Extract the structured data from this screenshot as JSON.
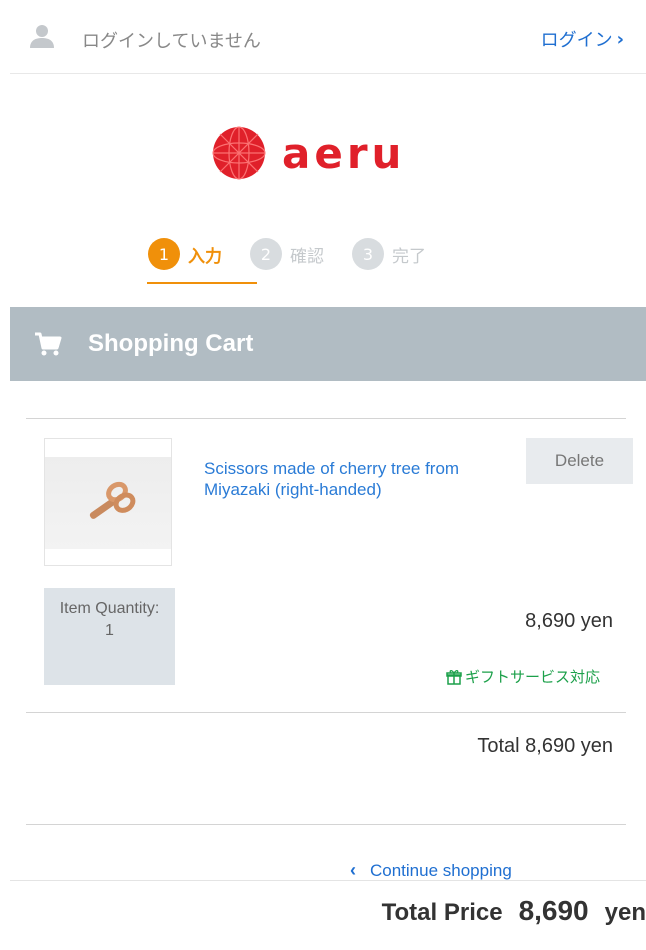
{
  "header": {
    "login_status": "ログインしていません",
    "login_link": "ログイン"
  },
  "brand": {
    "logo_text": "aeru",
    "brand_color": "#e0202a"
  },
  "steps": [
    {
      "num": "1",
      "label": "入力",
      "state": "active"
    },
    {
      "num": "2",
      "label": "確認",
      "state": "inactive"
    },
    {
      "num": "3",
      "label": "完了",
      "state": "inactive"
    }
  ],
  "cart": {
    "title": "Shopping Cart",
    "items": [
      {
        "name": "Scissors made of cherry tree from Miyazaki (right-handed)",
        "delete_label": "Delete",
        "quantity_label": "Item Quantity:",
        "quantity": "1",
        "price": "8,690 yen",
        "gift_label": "ギフトサービス対応"
      }
    ],
    "total_line": "Total 8,690 yen"
  },
  "actions": {
    "continue_shopping": "Continue shopping"
  },
  "summary": {
    "label": "Total Price",
    "value": "8,690",
    "unit": "yen"
  },
  "colors": {
    "accent": "#f0900a",
    "link": "#1f6fd1",
    "gift": "#1ca04a",
    "cart_header_bg": "#b1bcc3"
  }
}
